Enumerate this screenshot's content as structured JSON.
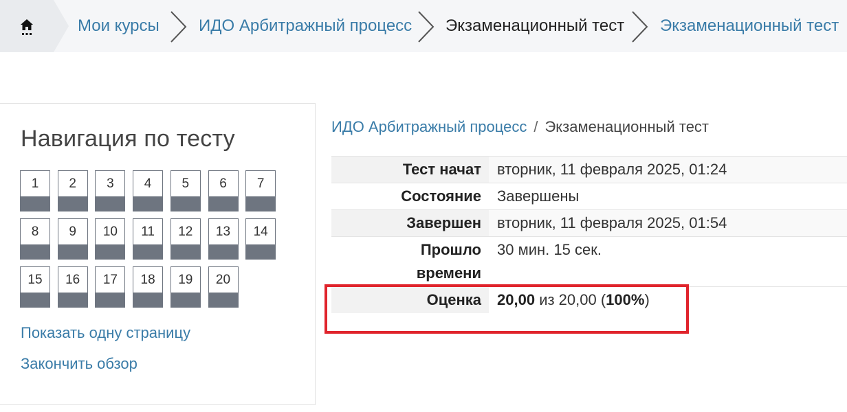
{
  "breadcrumb": {
    "items": [
      "Мои курсы",
      "ИДО Арбитражный процесс",
      "Экзаменационный тест",
      "Экзаменационный тест"
    ]
  },
  "nav": {
    "title": "Навигация по тесту",
    "questions": [
      "1",
      "2",
      "3",
      "4",
      "5",
      "6",
      "7",
      "8",
      "9",
      "10",
      "11",
      "12",
      "13",
      "14",
      "15",
      "16",
      "17",
      "18",
      "19",
      "20"
    ],
    "show_one_page": "Показать одну страницу",
    "finish_review": "Закончить обзор"
  },
  "summary": {
    "breadcrumb_course": "ИДО Арбитражный процесс",
    "breadcrumb_sep": "/",
    "breadcrumb_test": "Экзаменационный тест",
    "started_label": "Тест начат",
    "started_value": "вторник, 11 февраля 2025, 01:24",
    "state_label": "Состояние",
    "state_value": "Завершены",
    "finished_label": "Завершен",
    "finished_value": "вторник, 11 февраля 2025, 01:54",
    "elapsed_label_1": "Прошло",
    "elapsed_label_2": "времени",
    "elapsed_value": "30 мин. 15 сек.",
    "grade_label": "Оценка",
    "grade_score": "20,00",
    "grade_of": "из 20,00 (",
    "grade_percent": "100%",
    "grade_close": ")"
  },
  "colors": {
    "link": "#3a7ca8",
    "highlight": "#e0242c",
    "question_bar": "#6e7580"
  },
  "icons": {
    "home": "home-icon",
    "separator": "chevron-right-icon"
  }
}
